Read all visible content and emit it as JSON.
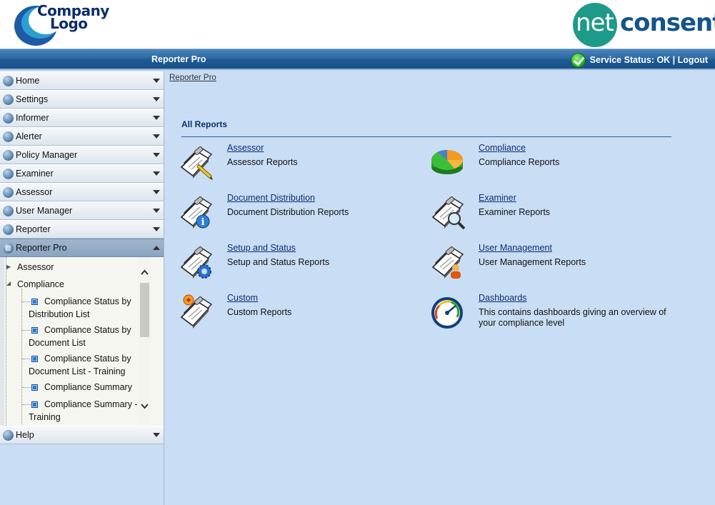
{
  "header": {
    "company_logo_line1": "Company",
    "company_logo_line2": "Logo",
    "brand_net": "net",
    "brand_consent": "consent"
  },
  "topbar": {
    "title": "Reporter Pro",
    "status": "Service Status: OK",
    "separator": " | ",
    "logout": "Logout"
  },
  "sidebar": {
    "items_top": [
      {
        "label": "Home",
        "icon": "home-icon"
      },
      {
        "label": "Settings",
        "icon": "settings-icon"
      },
      {
        "label": "Informer",
        "icon": "info-icon"
      },
      {
        "label": "Alerter",
        "icon": "alerter-icon"
      },
      {
        "label": "Policy Manager",
        "icon": "policy-icon"
      },
      {
        "label": "Examiner",
        "icon": "examiner-icon"
      },
      {
        "label": "Assessor",
        "icon": "assessor-icon"
      },
      {
        "label": "User Manager",
        "icon": "users-icon"
      },
      {
        "label": "Reporter",
        "icon": "reporter-icon"
      }
    ],
    "active": {
      "label": "Reporter Pro",
      "icon": "reporter-pro-icon"
    },
    "tree": {
      "assessor": "Assessor",
      "compliance": "Compliance",
      "leaves": [
        {
          "line1": "Compliance Status by",
          "line2": "Distribution List"
        },
        {
          "line1": "Compliance Status by",
          "line2": "Document List"
        },
        {
          "line1": "Compliance Status by",
          "line2": "Document List - Training"
        },
        {
          "line1": "Compliance Summary",
          "line2": ""
        },
        {
          "line1": "Compliance Summary -",
          "line2": "Training"
        }
      ]
    },
    "items_bottom": [
      {
        "label": "Help",
        "icon": "help-icon"
      }
    ]
  },
  "main": {
    "breadcrumb": "Reporter Pro",
    "section_title": "All Reports",
    "reports": [
      {
        "title": "Assessor",
        "desc": "Assessor Reports",
        "icon": "assessor-report-icon"
      },
      {
        "title": "Compliance",
        "desc": "Compliance Reports",
        "icon": "pie-chart-icon"
      },
      {
        "title": "Document Distribution",
        "desc": "Document Distribution Reports",
        "icon": "document-distribution-icon"
      },
      {
        "title": "Examiner",
        "desc": "Examiner Reports",
        "icon": "magnifier-report-icon"
      },
      {
        "title": "Setup and Status",
        "desc": "Setup and Status Reports",
        "icon": "gear-report-icon"
      },
      {
        "title": "User Management",
        "desc": "User Management Reports",
        "icon": "user-report-icon"
      },
      {
        "title": "Custom",
        "desc": "Custom Reports",
        "icon": "custom-report-icon"
      },
      {
        "title": "Dashboards",
        "desc": "This contains dashboards giving an overview of your compliance level",
        "icon": "dashboard-gauge-icon"
      }
    ]
  },
  "colors": {
    "topbar": "#2d6aa3",
    "background": "#c9ddf5",
    "link": "#0c2f6e",
    "brand_teal": "#1d9a88",
    "brand_blue": "#13548b"
  }
}
